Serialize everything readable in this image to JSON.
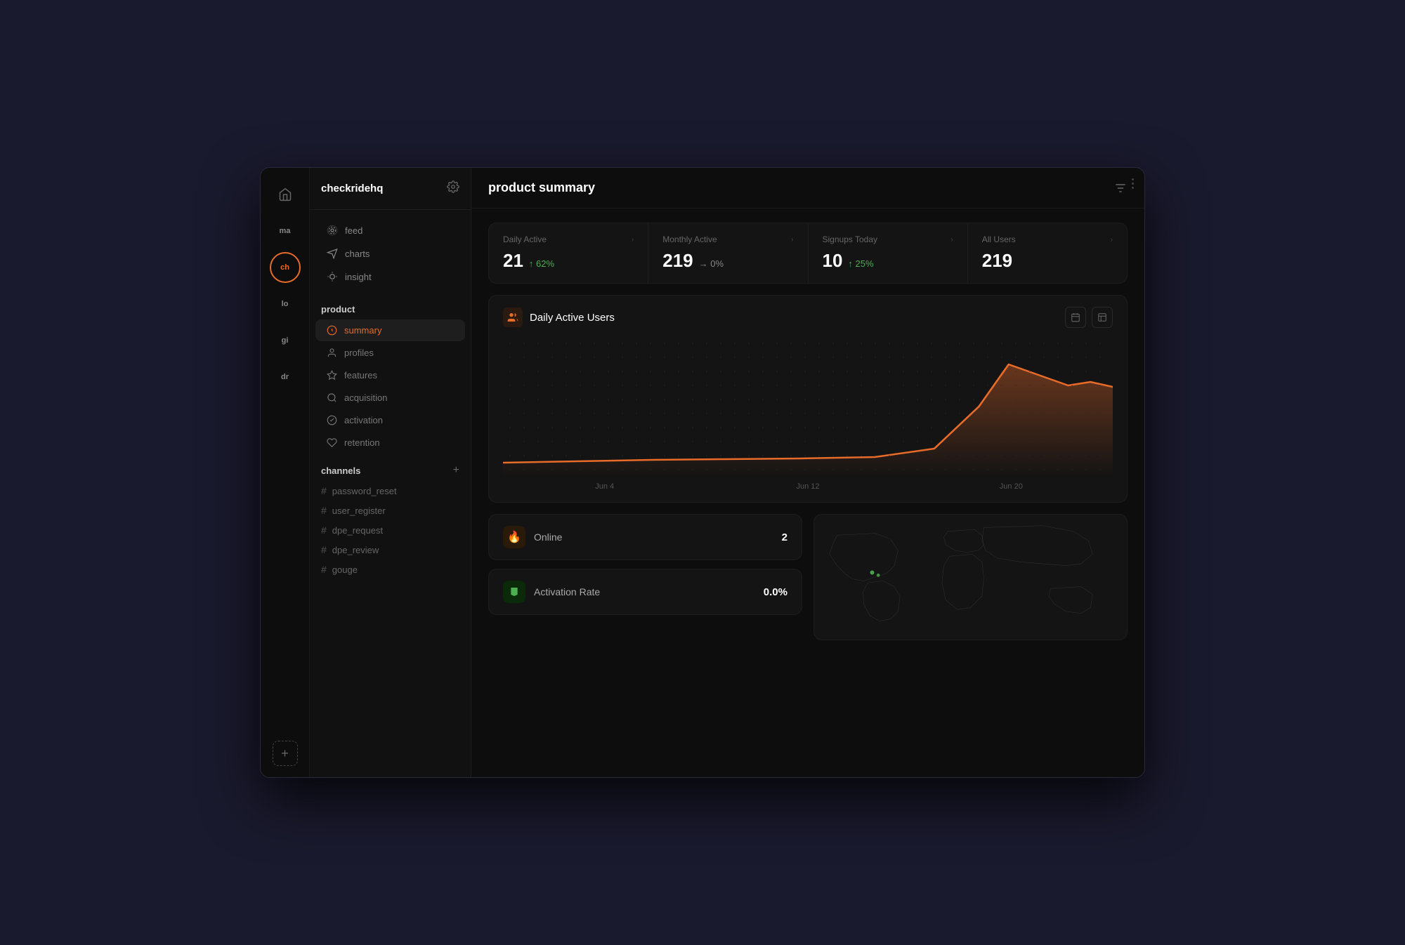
{
  "window": {
    "title": "checkridehq"
  },
  "header": {
    "title": "product summary",
    "filter_icon": "filter-icon"
  },
  "icon_rail": {
    "home_icon": "home-icon",
    "org_labels": [
      "ma",
      "ch",
      "lo",
      "gi",
      "dr"
    ],
    "active_org": "ch",
    "add_label": "+"
  },
  "sidebar": {
    "title": "checkridehq",
    "gear_icon": "gear-icon",
    "top_nav": [
      {
        "label": "feed",
        "icon": "feed-icon"
      },
      {
        "label": "charts",
        "icon": "charts-icon"
      },
      {
        "label": "insight",
        "icon": "insight-icon"
      }
    ],
    "product_section_label": "product",
    "product_items": [
      {
        "label": "summary",
        "icon": "summary-icon",
        "active": true
      },
      {
        "label": "profiles",
        "icon": "profiles-icon",
        "active": false
      },
      {
        "label": "features",
        "icon": "features-icon",
        "active": false
      },
      {
        "label": "acquisition",
        "icon": "acquisition-icon",
        "active": false
      },
      {
        "label": "activation",
        "icon": "activation-icon",
        "active": false
      },
      {
        "label": "retention",
        "icon": "retention-icon",
        "active": false
      }
    ],
    "channels_label": "channels",
    "channels_add": "+",
    "channels": [
      {
        "name": "password_reset"
      },
      {
        "name": "user_register"
      },
      {
        "name": "dpe_request"
      },
      {
        "name": "dpe_review"
      },
      {
        "name": "gouge"
      }
    ]
  },
  "stats": [
    {
      "label": "Daily Active",
      "value": "21",
      "change": "↑ 62%",
      "change_type": "up"
    },
    {
      "label": "Monthly Active",
      "value": "219",
      "change": "→ 0%",
      "change_type": "flat"
    },
    {
      "label": "Signups Today",
      "value": "10",
      "change": "↑ 25%",
      "change_type": "up"
    },
    {
      "label": "All Users",
      "value": "219",
      "change": "",
      "change_type": ""
    }
  ],
  "chart": {
    "title": "Daily Active Users",
    "icon": "users-icon",
    "calendar_icon": "calendar-icon",
    "export_icon": "export-icon",
    "x_labels": [
      "Jun 4",
      "Jun 12",
      "Jun 20"
    ]
  },
  "metrics": [
    {
      "icon": "🔥",
      "icon_type": "orange",
      "label": "Online",
      "value": "2"
    },
    {
      "icon": "🚩",
      "icon_type": "green",
      "label": "Activation Rate",
      "value": "0.0%"
    }
  ]
}
